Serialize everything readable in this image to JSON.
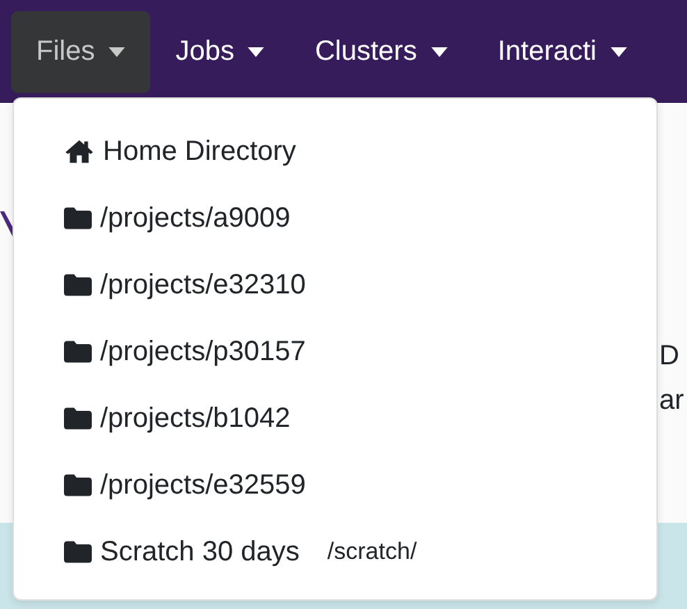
{
  "navbar": {
    "items": [
      {
        "label": "Files",
        "selected": true
      },
      {
        "label": "Jobs",
        "selected": false
      },
      {
        "label": "Clusters",
        "selected": false
      },
      {
        "label": "Interacti",
        "selected": false
      }
    ]
  },
  "files_menu": {
    "items": [
      {
        "kind": "home",
        "label": "Home Directory"
      },
      {
        "kind": "folder",
        "label": "/projects/a9009"
      },
      {
        "kind": "folder",
        "label": "/projects/e32310"
      },
      {
        "kind": "folder",
        "label": "/projects/p30157"
      },
      {
        "kind": "folder",
        "label": "/projects/b1042"
      },
      {
        "kind": "folder",
        "label": "/projects/e32559"
      },
      {
        "kind": "folder",
        "label": "Scratch 30 days",
        "path": "/scratch/"
      }
    ]
  },
  "background": {
    "right_fragments": [
      "D",
      "ar"
    ]
  }
}
